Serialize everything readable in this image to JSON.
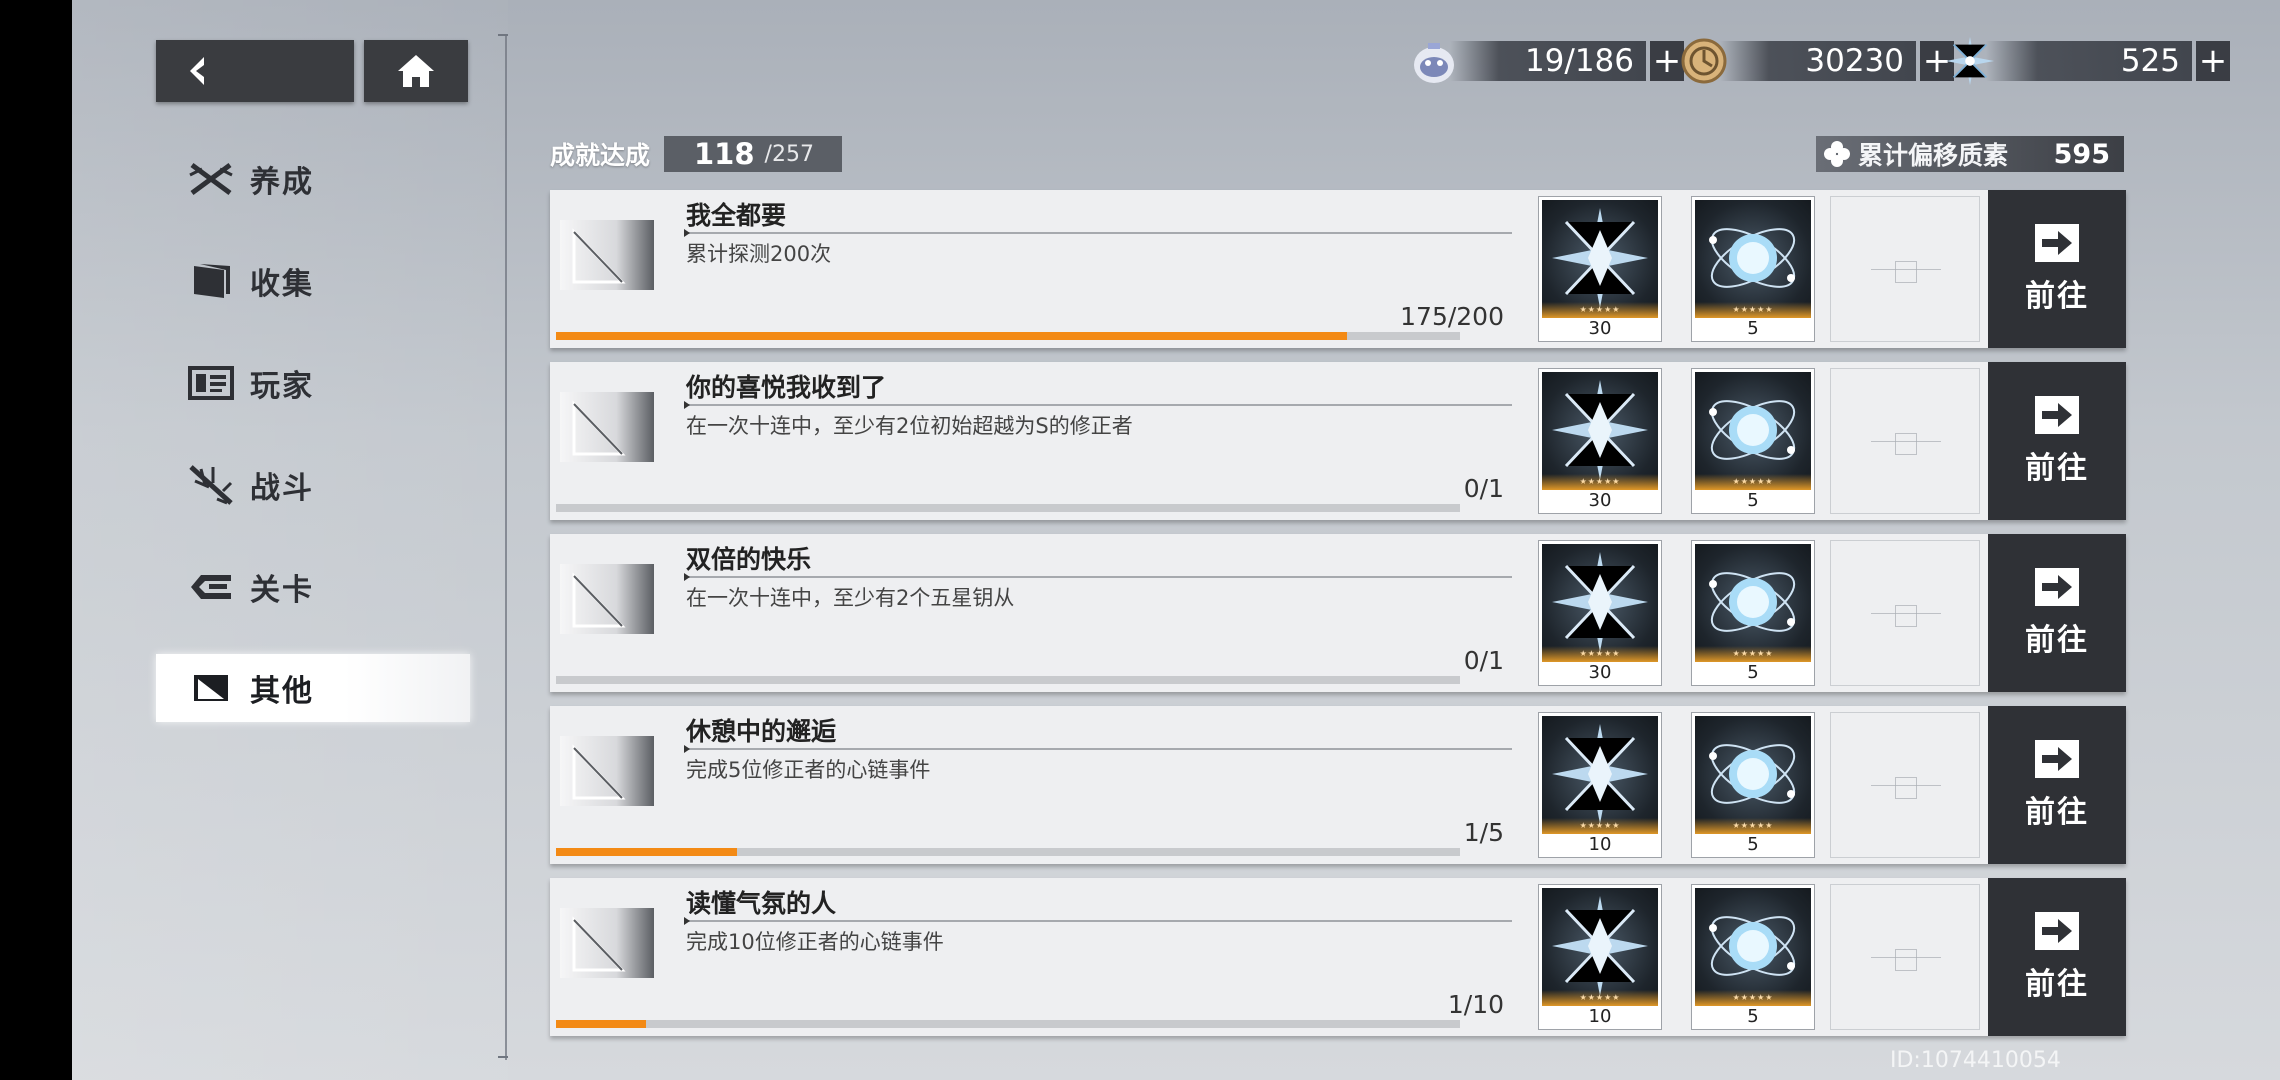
{
  "header": {
    "resources": [
      {
        "icon": "stamina-bot-icon",
        "value": "19/186"
      },
      {
        "icon": "coin-icon",
        "value": "30230"
      },
      {
        "icon": "crystal-shard-icon",
        "value": "525"
      }
    ]
  },
  "sidebar": {
    "items": [
      {
        "label": "养成",
        "icon": "crossed-swords-icon"
      },
      {
        "label": "收集",
        "icon": "folder-icon"
      },
      {
        "label": "玩家",
        "icon": "id-card-icon"
      },
      {
        "label": "战斗",
        "icon": "weapon-icon"
      },
      {
        "label": "关卡",
        "icon": "stage-flag-icon"
      },
      {
        "label": "其他",
        "icon": "misc-square-icon",
        "active": true
      }
    ]
  },
  "achievement": {
    "label": "成就达成",
    "count": "118",
    "total": "/257"
  },
  "accumulated": {
    "label": "累计偏移质素",
    "value": "595"
  },
  "cards": [
    {
      "title": "我全都要",
      "desc": "累计探测200次",
      "progress": "175/200",
      "fraction": 0.875,
      "rewards": [
        "30",
        "5"
      ],
      "go": "前往"
    },
    {
      "title": "你的喜悦我收到了",
      "desc": "在一次十连中，至少有2位初始超越为S的修正者",
      "progress": "0/1",
      "fraction": 0,
      "rewards": [
        "30",
        "5"
      ],
      "go": "前往"
    },
    {
      "title": "双倍的快乐",
      "desc": "在一次十连中，至少有2个五星钥从",
      "progress": "0/1",
      "fraction": 0,
      "rewards": [
        "30",
        "5"
      ],
      "go": "前往"
    },
    {
      "title": "休憩中的邂逅",
      "desc": "完成5位修正者的心链事件",
      "progress": "1/5",
      "fraction": 0.2,
      "rewards": [
        "10",
        "5"
      ],
      "go": "前往"
    },
    {
      "title": "读懂气氛的人",
      "desc": "完成10位修正者的心链事件",
      "progress": "1/10",
      "fraction": 0.1,
      "rewards": [
        "10",
        "5"
      ],
      "go": "前往"
    }
  ],
  "footer": {
    "id": "ID:1074410054"
  },
  "colors": {
    "accent": "#f38a15",
    "button_dark": "#2f3136"
  }
}
